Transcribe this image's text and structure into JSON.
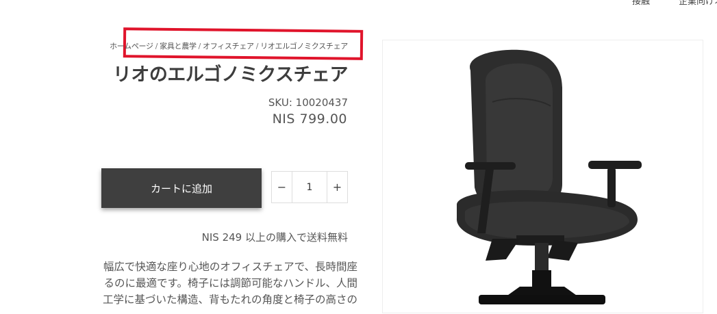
{
  "topnav": {
    "item1": "接触",
    "item2": "企業向けオフ"
  },
  "breadcrumb": [
    {
      "label": "ホームページ"
    },
    {
      "label": "家具と農学"
    },
    {
      "label": "オフィスチェア"
    },
    {
      "label": "リオエルゴノミクスチェア"
    }
  ],
  "breadcrumb_separator": "/",
  "product": {
    "title": "リオのエルゴノミクスチェア",
    "sku": "SKU: 10020437",
    "price": "NIS 799.00",
    "add_to_cart_label": "カートに追加",
    "quantity": "1",
    "minus_label": "−",
    "plus_label": "+",
    "shipping_note": "NIS 249 以上の購入で送料無料",
    "description": "幅広で快適な座り心地のオフィスチェアで、長時間座るのに最適です。椅子には調節可能なハンドル、人間工学に基づいた構造、背もたれの角度と椅子の高さの"
  },
  "colors": {
    "highlight_border": "#e0142b",
    "button_bg": "#3f3f3f"
  },
  "icons": {
    "chevron": "chevron-down-icon"
  }
}
